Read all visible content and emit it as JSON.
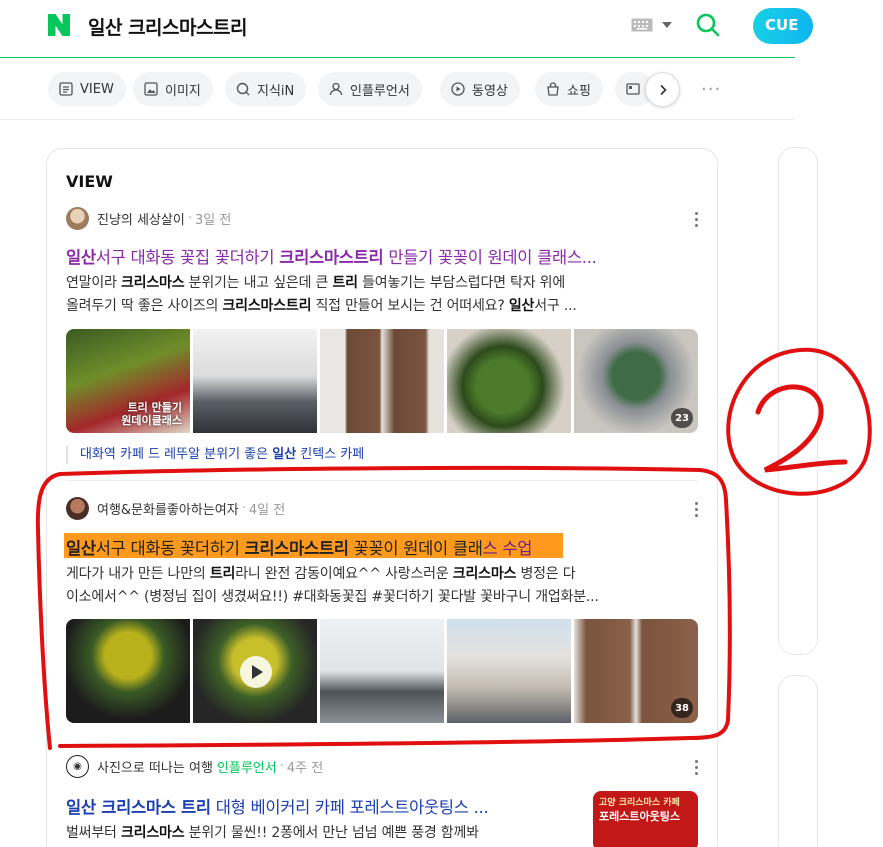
{
  "header": {
    "query": "일산 크리스마스트리",
    "cue_label": "CUE"
  },
  "tabs": [
    {
      "label": "VIEW",
      "icon": "view-icon"
    },
    {
      "label": "이미지",
      "icon": "image-icon"
    },
    {
      "label": "지식iN",
      "icon": "knowledge-icon"
    },
    {
      "label": "인플루언서",
      "icon": "influencer-icon"
    },
    {
      "label": "동영상",
      "icon": "video-icon"
    },
    {
      "label": "쇼핑",
      "icon": "shopping-icon"
    }
  ],
  "section_title": "VIEW",
  "posts": [
    {
      "author": "진냥의 세상살이",
      "time": "3일 전",
      "title_parts": [
        "일산",
        "서구 대화동 꽃집 꽃더하기 ",
        "크리스마스트리",
        " 만들기 꽃꽂이 원데이 클래스..."
      ],
      "desc_line1_parts": [
        "연말이라 ",
        "크리스마스",
        " 분위기는 내고 싶은데 큰 ",
        "트리",
        " 들여놓기는 부담스럽다면 탁자 위에"
      ],
      "desc_line2_parts": [
        "올려두기 딱 좋은 사이즈의 ",
        "크리스마스트리",
        " 직접 만들어 보시는 건 어떠세요? ",
        "일산",
        "서구 ..."
      ],
      "thumb_caption": "트리 만들기\n원데이클래스",
      "image_count": "23",
      "related_parts": [
        "대화역 카페 드 레뚜알 분위기 좋은 ",
        "일산",
        " 킨텍스 카페"
      ]
    },
    {
      "author": "여행&문화를좋아하는여자",
      "time": "4일 전",
      "title_parts": [
        "일산",
        "서구 대화동 꽃더하기 ",
        "크리스마스트리",
        " 꽃꽂이 원데이 클래",
        "스 수업"
      ],
      "desc_line1_parts": [
        "게다가 내가 만든 나만의 ",
        "트리",
        "라니 완전 감동이예요^^ 사랑스러운 ",
        "크리스마스",
        " 병정은 다"
      ],
      "desc_line2": "이소에서^^ (병정님 집이 생겼써요!!) #대화동꽃집 #꽃더하기 꽃다발 꽃바구니 개업화분...",
      "image_count": "38"
    },
    {
      "author": "사진으로 떠나는 여행",
      "badge": "인플루언서",
      "time": "4주 전",
      "title_parts": [
        "일산 크리스마스 트리",
        " 대형 베이커리 카페 포레스트아웃팅스 ..."
      ],
      "desc_parts": [
        "벌써부터 ",
        "크리스마스",
        " 분위기 물씬!! 2퐁에서 만난 넘넘 예쁜 풍경 함께봐"
      ],
      "ad_line1": "고양 크리스마스 카페",
      "ad_line2": "포레스트아웃팅스"
    }
  ],
  "colors": {
    "brand": "#03c75a",
    "visited_title": "#8b2aa8",
    "title": "#1a3fb0",
    "highlight": "#ff9a1f",
    "annotation": "#e01010"
  }
}
